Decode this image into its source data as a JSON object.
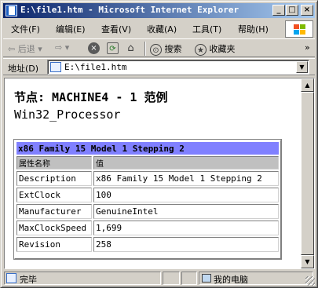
{
  "window": {
    "title": "E:\\file1.htm - Microsoft Internet Explorer",
    "minimize_glyph": "_",
    "maximize_glyph": "□",
    "close_glyph": "×"
  },
  "menu": {
    "items": [
      {
        "label": "文件(F)"
      },
      {
        "label": "编辑(E)"
      },
      {
        "label": "查看(V)"
      },
      {
        "label": "收藏(A)"
      },
      {
        "label": "工具(T)"
      },
      {
        "label": "帮助(H)"
      }
    ]
  },
  "toolbar": {
    "back_glyph": "⇦",
    "back_label": "后退",
    "forward_glyph": "⇨",
    "stop_glyph": "×",
    "refresh_glyph": "⟳",
    "home_glyph": "⌂",
    "search_glyph": "⊙",
    "search_label": "搜索",
    "favorites_glyph": "★",
    "favorites_label": "收藏夹",
    "more_glyph": "»"
  },
  "address": {
    "label": "地址(D)",
    "value": "E:\\file1.htm",
    "dropdown_glyph": "▼"
  },
  "page": {
    "heading": "节点: MACHINE4 - 1 范例",
    "subheading": "Win32_Processor",
    "table": {
      "caption": "x86 Family 15 Model 1 Stepping 2",
      "columns": [
        "属性名称",
        "值"
      ],
      "rows": [
        [
          "Description",
          "x86 Family 15 Model 1 Stepping 2"
        ],
        [
          "ExtClock",
          "100"
        ],
        [
          "Manufacturer",
          "GenuineIntel"
        ],
        [
          "MaxClockSpeed",
          "1,699"
        ],
        [
          "Revision",
          "258"
        ]
      ]
    }
  },
  "scrollbar": {
    "up_glyph": "▲",
    "down_glyph": "▼"
  },
  "status": {
    "left_text": "完毕",
    "zone_text": "我的电脑"
  },
  "colors": {
    "title_gradient_start": "#0a246a",
    "title_gradient_end": "#a6caf0",
    "table_caption_bg": "#8080ff",
    "table_header_bg": "#c0c0c0",
    "chrome": "#d4d0c8"
  }
}
